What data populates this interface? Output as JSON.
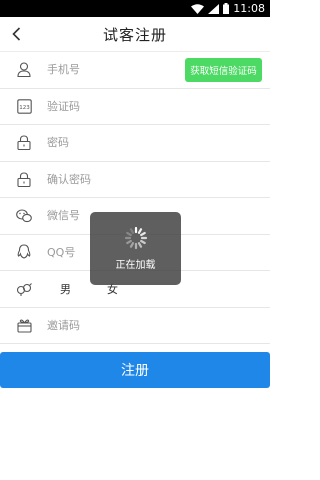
{
  "status_bar": {
    "time": "11:08"
  },
  "header": {
    "title": "试客注册"
  },
  "form": {
    "phone_placeholder": "手机号",
    "sms_button": "获取短信验证码",
    "code_placeholder": "验证码",
    "password_placeholder": "密码",
    "confirm_password_placeholder": "确认密码",
    "wechat_placeholder": "微信号",
    "qq_placeholder": "QQ号",
    "gender": {
      "male": "男",
      "female": "女"
    },
    "invite_placeholder": "邀请码"
  },
  "submit_label": "注册",
  "loading_text": "正在加载",
  "colors": {
    "accent": "#1f87e8",
    "sms_button": "#4cd964"
  }
}
